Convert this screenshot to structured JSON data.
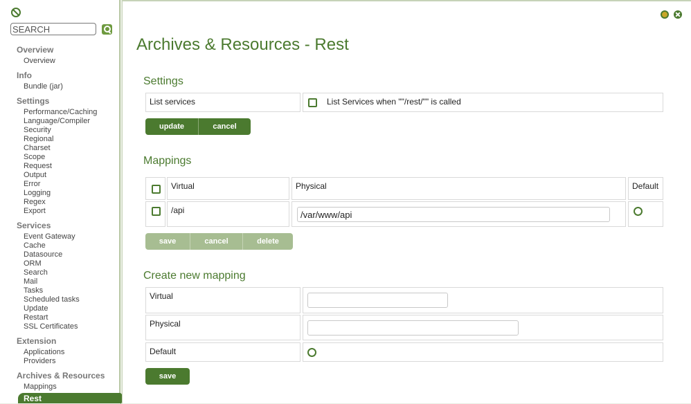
{
  "sidebar": {
    "search_placeholder": "SEARCH",
    "sections": [
      {
        "title": "Overview",
        "items": [
          "Overview"
        ]
      },
      {
        "title": "Info",
        "items": [
          "Bundle (jar)"
        ]
      },
      {
        "title": "Settings",
        "items": [
          "Performance/Caching",
          "Language/Compiler",
          "Security",
          "Regional",
          "Charset",
          "Scope",
          "Request",
          "Output",
          "Error",
          "Logging",
          "Regex",
          "Export"
        ]
      },
      {
        "title": "Services",
        "items": [
          "Event Gateway",
          "Cache",
          "Datasource",
          "ORM",
          "Search",
          "Mail",
          "Tasks",
          "Scheduled tasks",
          "Update",
          "Restart",
          "SSL Certificates"
        ]
      },
      {
        "title": "Extension",
        "items": [
          "Applications",
          "Providers"
        ]
      },
      {
        "title": "Archives & Resources",
        "items": [
          "Mappings",
          "Rest"
        ]
      }
    ],
    "active_item": "Rest"
  },
  "page": {
    "title": "Archives & Resources - Rest"
  },
  "settings": {
    "heading": "Settings",
    "list_services_label": "List services",
    "list_services_desc": "List Services when \"\"/rest/\"\" is called",
    "list_services_checked": false,
    "update_label": "update",
    "cancel_label": "cancel"
  },
  "mappings": {
    "heading": "Mappings",
    "columns": {
      "virtual": "Virtual",
      "physical": "Physical",
      "default": "Default"
    },
    "rows": [
      {
        "virtual": "/api",
        "physical": "/var/www/api",
        "default": false
      }
    ],
    "save_label": "save",
    "cancel_label": "cancel",
    "delete_label": "delete"
  },
  "create": {
    "heading": "Create new mapping",
    "virtual_label": "Virtual",
    "physical_label": "Physical",
    "default_label": "Default",
    "virtual_value": "",
    "physical_value": "",
    "save_label": "save"
  },
  "colors": {
    "accent": "#4b7a2f",
    "button": "#4b7a2f",
    "button_disabled": "#a7bd92",
    "background": "#e9eee3"
  }
}
